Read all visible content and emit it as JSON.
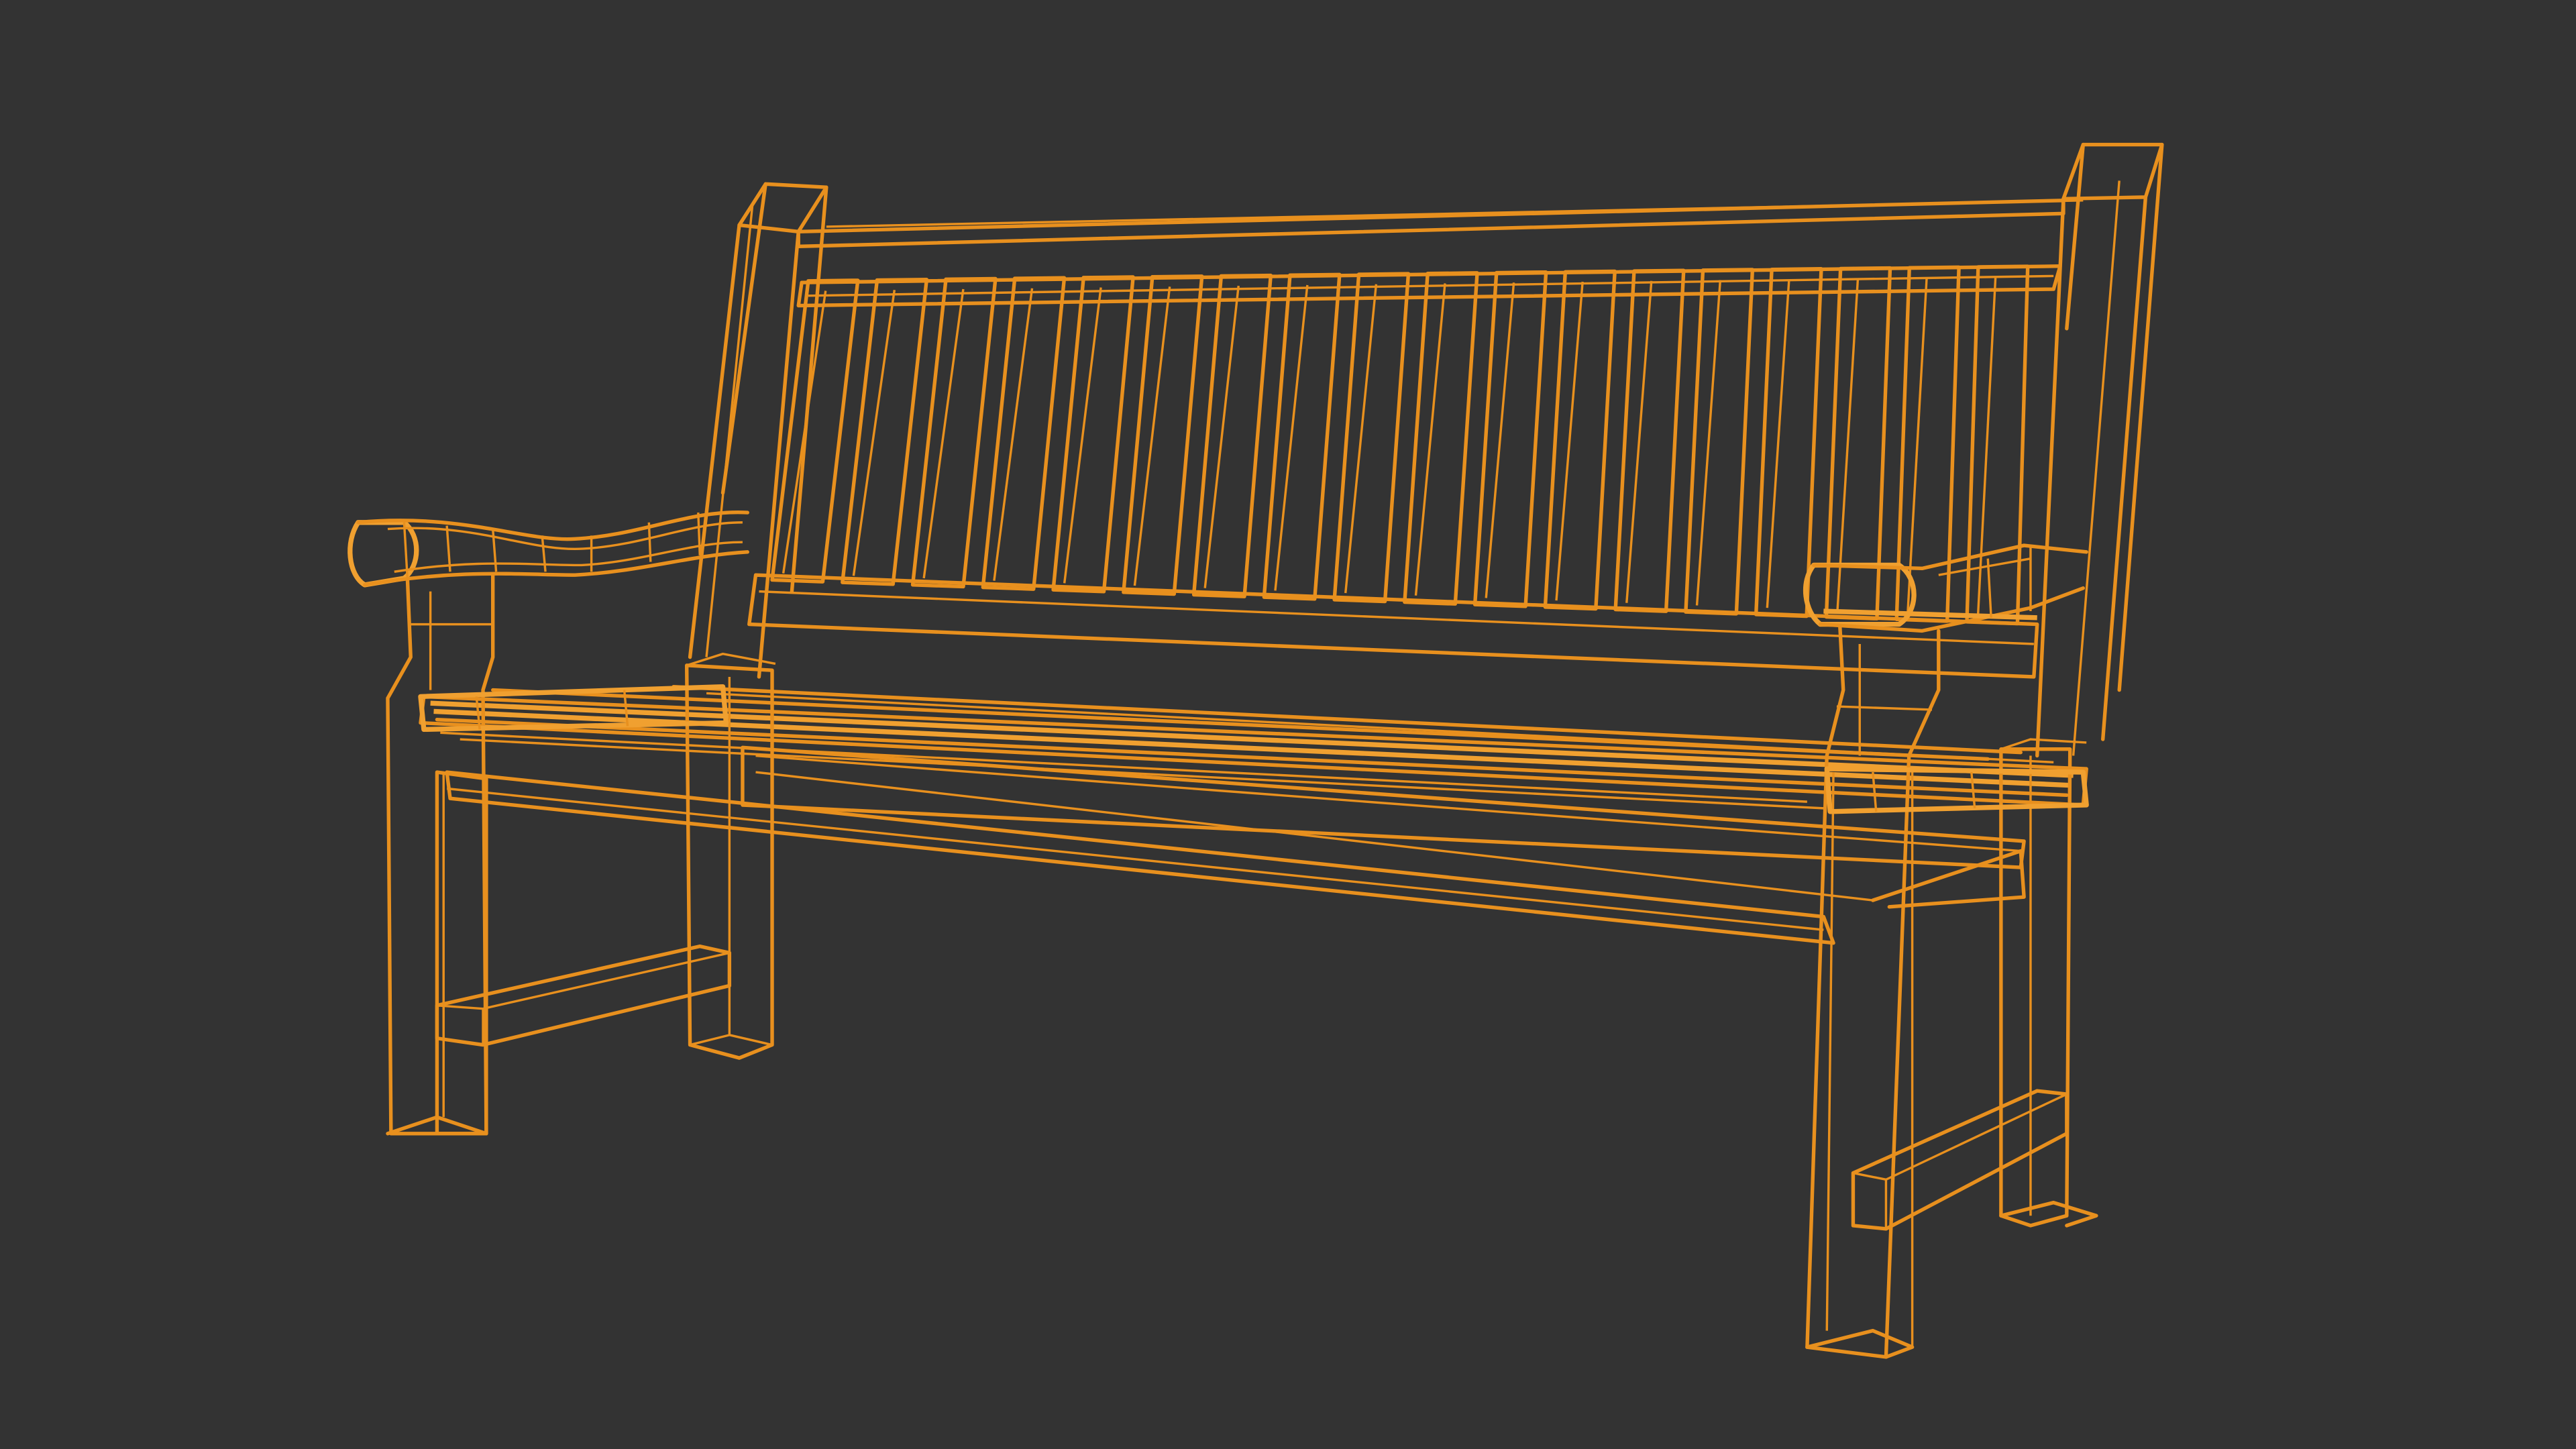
{
  "viewport": {
    "background_color": "#333333",
    "wire_color": "#e8901e",
    "wire_color_dense": "#f0a030",
    "display_mode": "wireframe"
  },
  "model": {
    "subject": "garden bench"
  }
}
